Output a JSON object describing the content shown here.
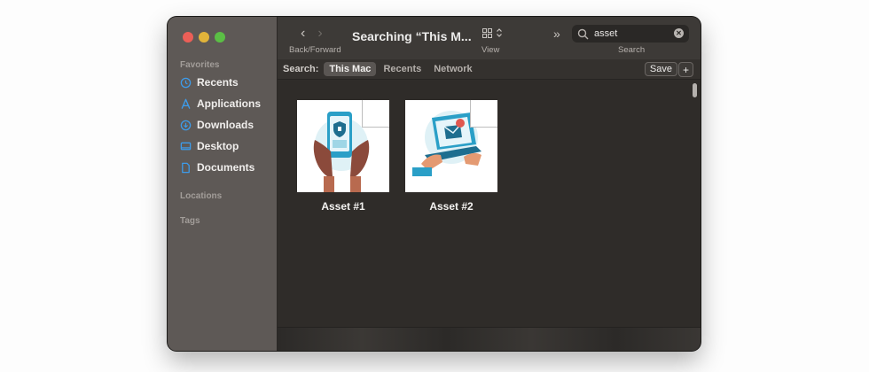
{
  "sidebar": {
    "favorites_label": "Favorites",
    "items": [
      {
        "label": "Recents",
        "icon": "clock-icon"
      },
      {
        "label": "Applications",
        "icon": "applications-icon"
      },
      {
        "label": "Downloads",
        "icon": "download-icon"
      },
      {
        "label": "Desktop",
        "icon": "desktop-icon"
      },
      {
        "label": "Documents",
        "icon": "document-icon"
      }
    ],
    "locations_label": "Locations",
    "tags_label": "Tags"
  },
  "toolbar": {
    "title": "Searching “This M...",
    "back_forward_label": "Back/Forward",
    "view_label": "View",
    "search_label": "Search"
  },
  "search": {
    "value": "asset"
  },
  "scope": {
    "label": "Search:",
    "options": [
      "This Mac",
      "Recents",
      "Network"
    ],
    "active": "This Mac",
    "save_label": "Save",
    "add_label": "+"
  },
  "files": [
    {
      "name": "Asset #1",
      "icon": "phone-security-illustration"
    },
    {
      "name": "Asset #2",
      "icon": "laptop-email-illustration"
    }
  ],
  "colors": {
    "accent": "#3d9be9",
    "window_bg": "#2f2c29",
    "sidebar_bg": "#5e5956"
  }
}
